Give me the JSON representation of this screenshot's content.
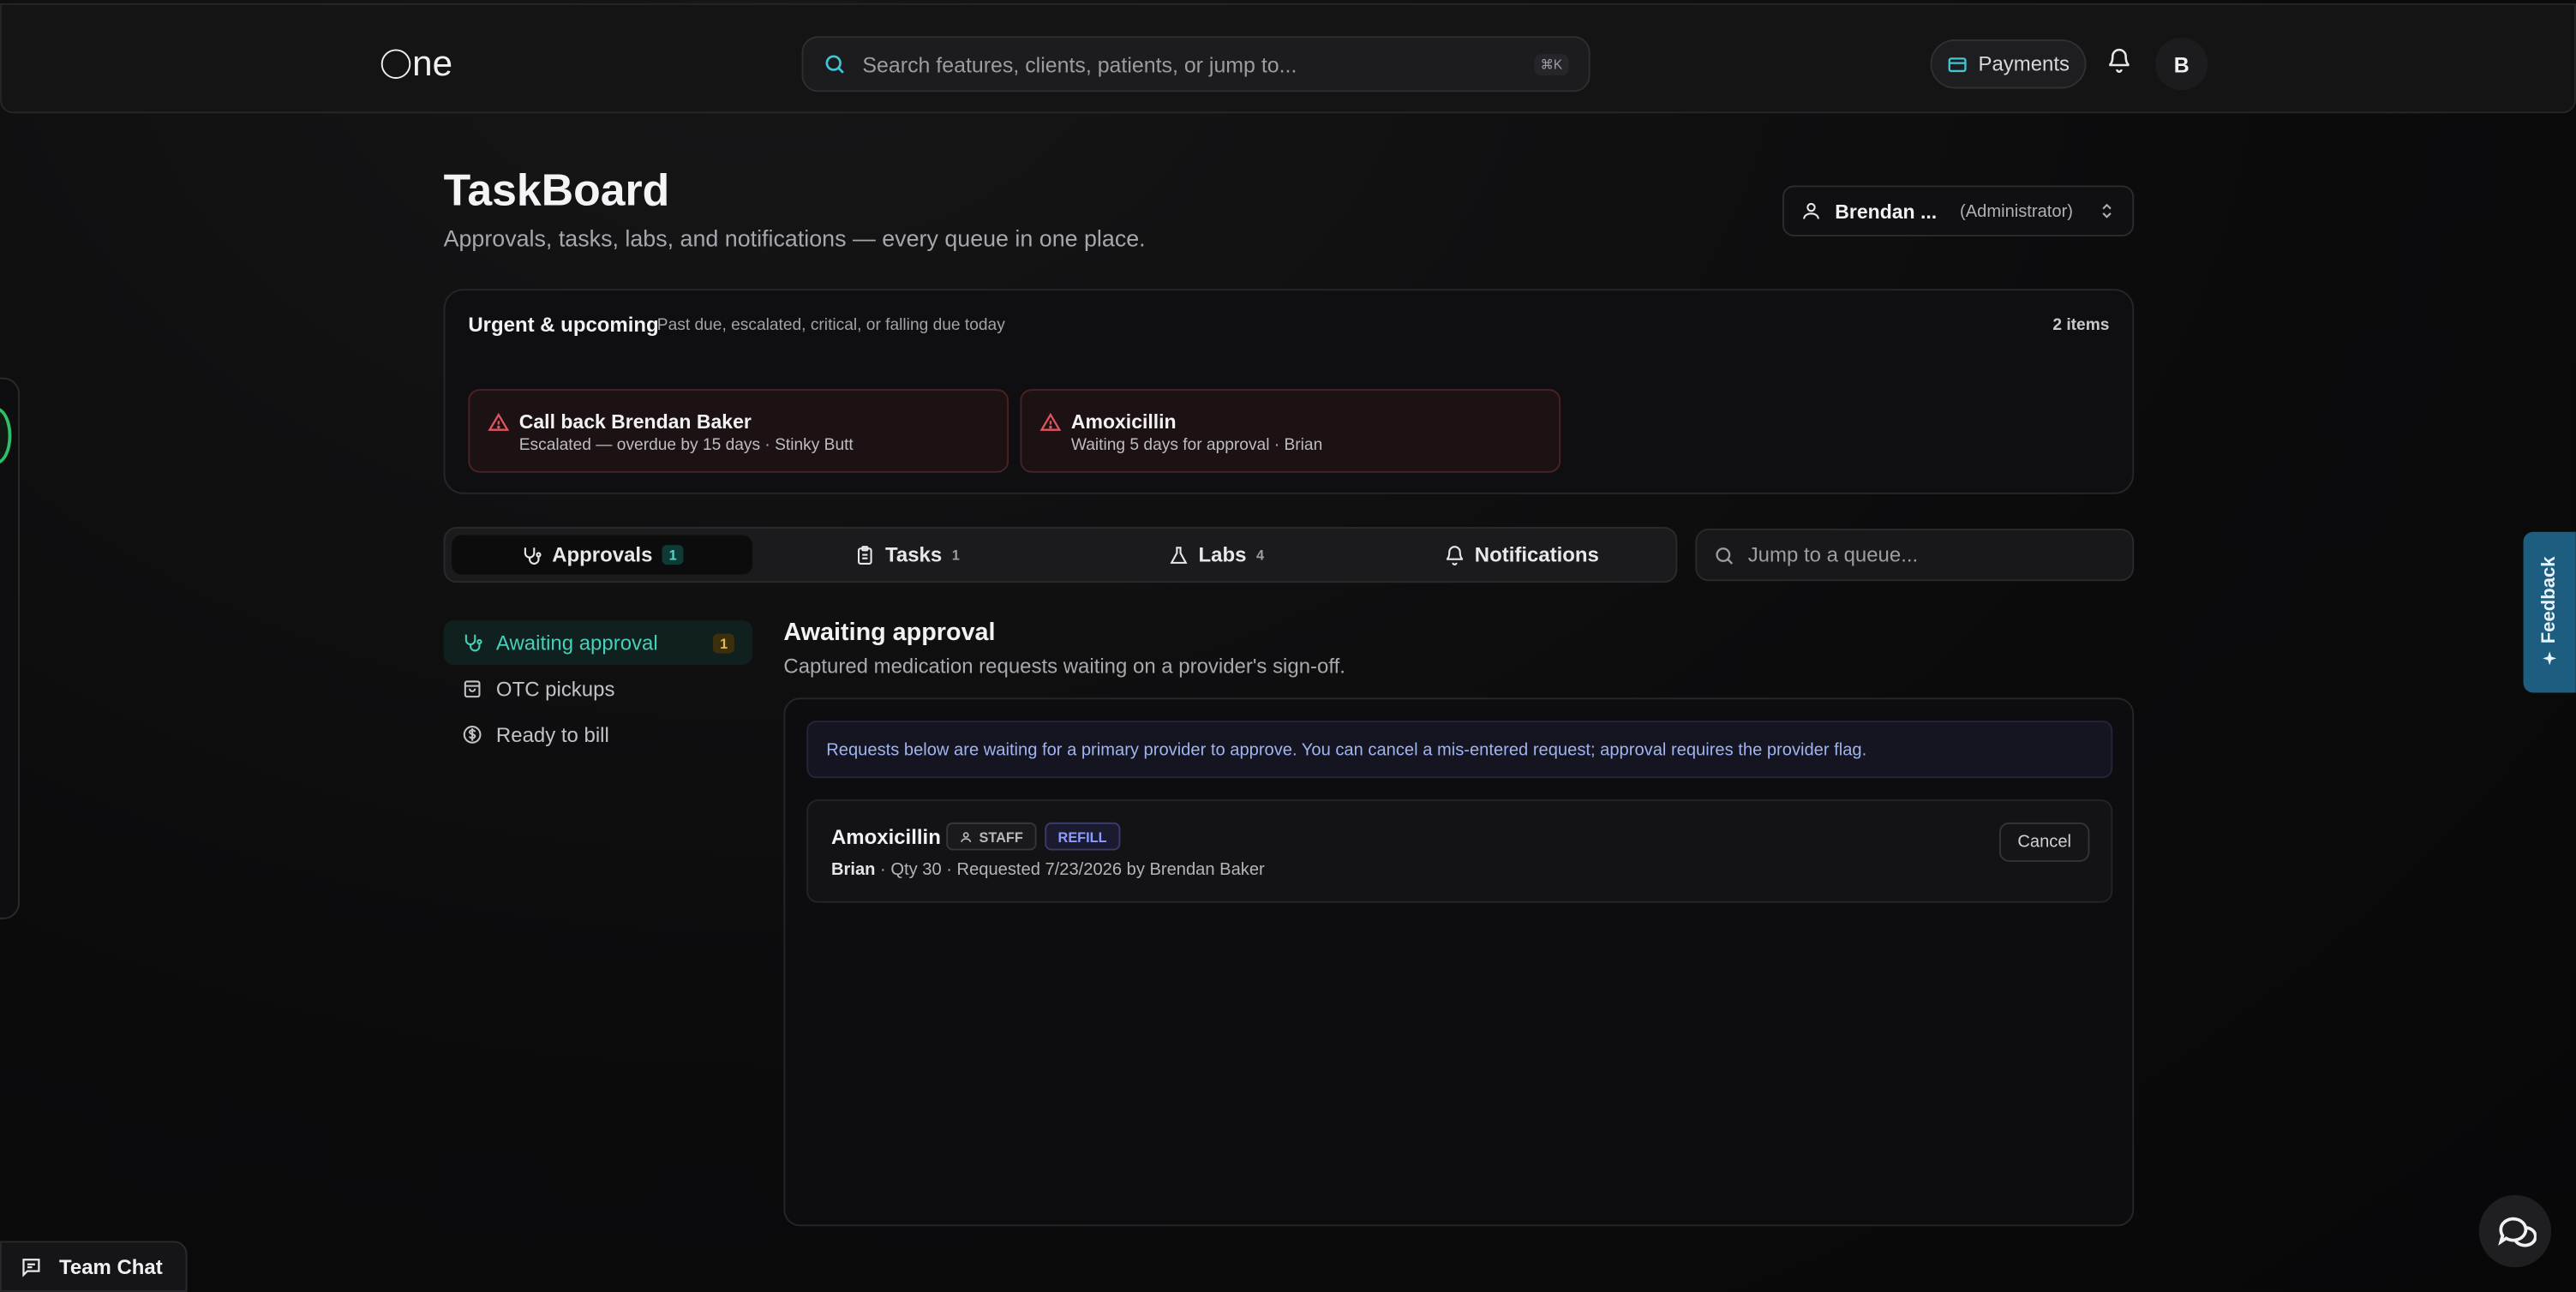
{
  "header": {
    "logo_text": "ne",
    "search_placeholder": "Search features, clients, patients, or jump to...",
    "search_shortcut": "⌘K",
    "payments_label": "Payments",
    "avatar_initial": "B"
  },
  "page": {
    "title": "TaskBoard",
    "subtitle": "Approvals, tasks, labs, and notifications — every queue in one place."
  },
  "user_select": {
    "name": "Brendan ...",
    "role": "(Administrator)"
  },
  "urgent": {
    "title": "Urgent & upcoming",
    "description": "Past due, escalated, critical, or falling due today",
    "count": "2 items",
    "cards": [
      {
        "title": "Call back Brendan Baker",
        "sub": "Escalated — overdue by 15 days · Stinky Butt"
      },
      {
        "title": "Amoxicillin",
        "sub": "Waiting 5 days for approval · Brian"
      }
    ]
  },
  "tabs": [
    {
      "label": "Approvals",
      "count": "1"
    },
    {
      "label": "Tasks",
      "count": "1"
    },
    {
      "label": "Labs",
      "count": "4"
    },
    {
      "label": "Notifications",
      "count": ""
    }
  ],
  "jump_placeholder": "Jump to a queue...",
  "sub_nav": [
    {
      "label": "Awaiting approval",
      "badge": "1"
    },
    {
      "label": "OTC pickups",
      "badge": ""
    },
    {
      "label": "Ready to bill",
      "badge": ""
    }
  ],
  "section": {
    "title": "Awaiting approval",
    "subtitle": "Captured medication requests waiting on a provider's sign-off.",
    "info": "Requests below are waiting for a primary provider to approve. You can cancel a mis-entered request; approval requires the provider flag."
  },
  "request": {
    "title": "Amoxicillin",
    "staff_tag": "STAFF",
    "refill_tag": "REFILL",
    "patient": "Brian",
    "meta": " · Qty 30 · Requested 7/23/2026 by Brendan Baker",
    "cancel_label": "Cancel"
  },
  "feedback_label": "Feedback",
  "team_chat_label": "Team Chat",
  "colors": {
    "accent_teal": "#45d0ba",
    "danger": "#e2545c",
    "refill": "#8e9cff",
    "feedback_bg": "#1d5d80"
  }
}
